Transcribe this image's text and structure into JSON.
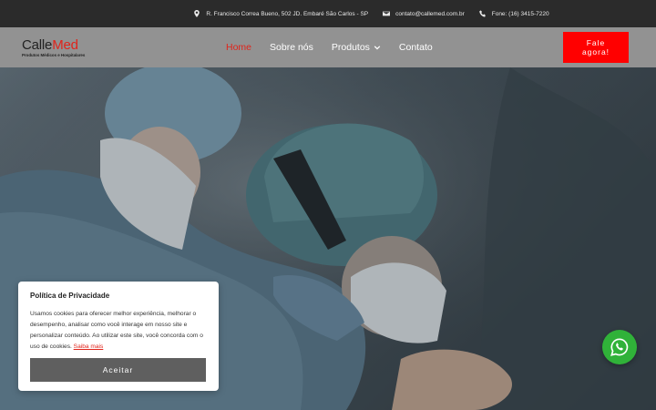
{
  "topbar": {
    "address": "R. Francisco Correa Bueno, 502 JD. Embaré São Carlos - SP",
    "email": "contato@callemed.com.br",
    "phone": "Fone: (16) 3415-7220"
  },
  "logo": {
    "part1": "Calle",
    "part2": "Med",
    "tagline": "Produtos Médicos e Hospitalares"
  },
  "nav": {
    "items": [
      "Home",
      "Sobre nós",
      "Produtos",
      "Contato"
    ],
    "active": "Home"
  },
  "cta": {
    "line1": "Fale",
    "line2": "agora!"
  },
  "cookie": {
    "title": "Política de Privacidade",
    "text": "Usamos cookies para oferecer melhor experiência, melhorar o desempenho, analisar como você interage em nosso site e personalizar conteúdo. Ao utilizar este site, você concorda com o uso de cookies.",
    "link": "Saiba mais",
    "accept": "Aceitar"
  },
  "colors": {
    "accent": "#e0241b",
    "cta": "#ff0000",
    "whatsapp": "#30b239"
  }
}
